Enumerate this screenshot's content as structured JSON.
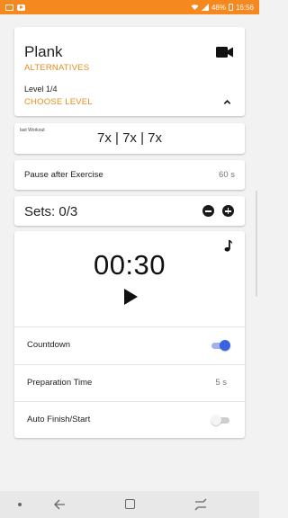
{
  "status_bar": {
    "battery": "48%",
    "time": "16:56"
  },
  "exercise": {
    "title": "Plank",
    "alternatives_label": "ALTERNATIVES",
    "level": "Level 1/4",
    "choose_level_label": "CHOOSE LEVEL"
  },
  "last_workout": {
    "label": "last Workout",
    "value": "7x | 7x | 7x"
  },
  "pause": {
    "label": "Pause after Exercise",
    "value": "60 s"
  },
  "sets": {
    "label": "Sets: 0/3"
  },
  "timer": {
    "time": "00:30",
    "countdown_label": "Countdown",
    "countdown_on": true,
    "preparation_label": "Preparation Time",
    "preparation_value": "5 s",
    "auto_finish_label": "Auto Finish/Start",
    "auto_finish_on": false
  },
  "colors": {
    "status_bar": "#f5891f",
    "accent": "#e58d1c",
    "toggle_on": "#3a63e0"
  },
  "icons": [
    "gallery-icon",
    "youtube-icon",
    "wifi-icon",
    "battery-icon",
    "video-camera-icon",
    "chevron-up-icon",
    "minus-icon",
    "plus-icon",
    "music-note-icon",
    "play-icon",
    "back-icon",
    "recent-apps-icon",
    "home-icon"
  ]
}
